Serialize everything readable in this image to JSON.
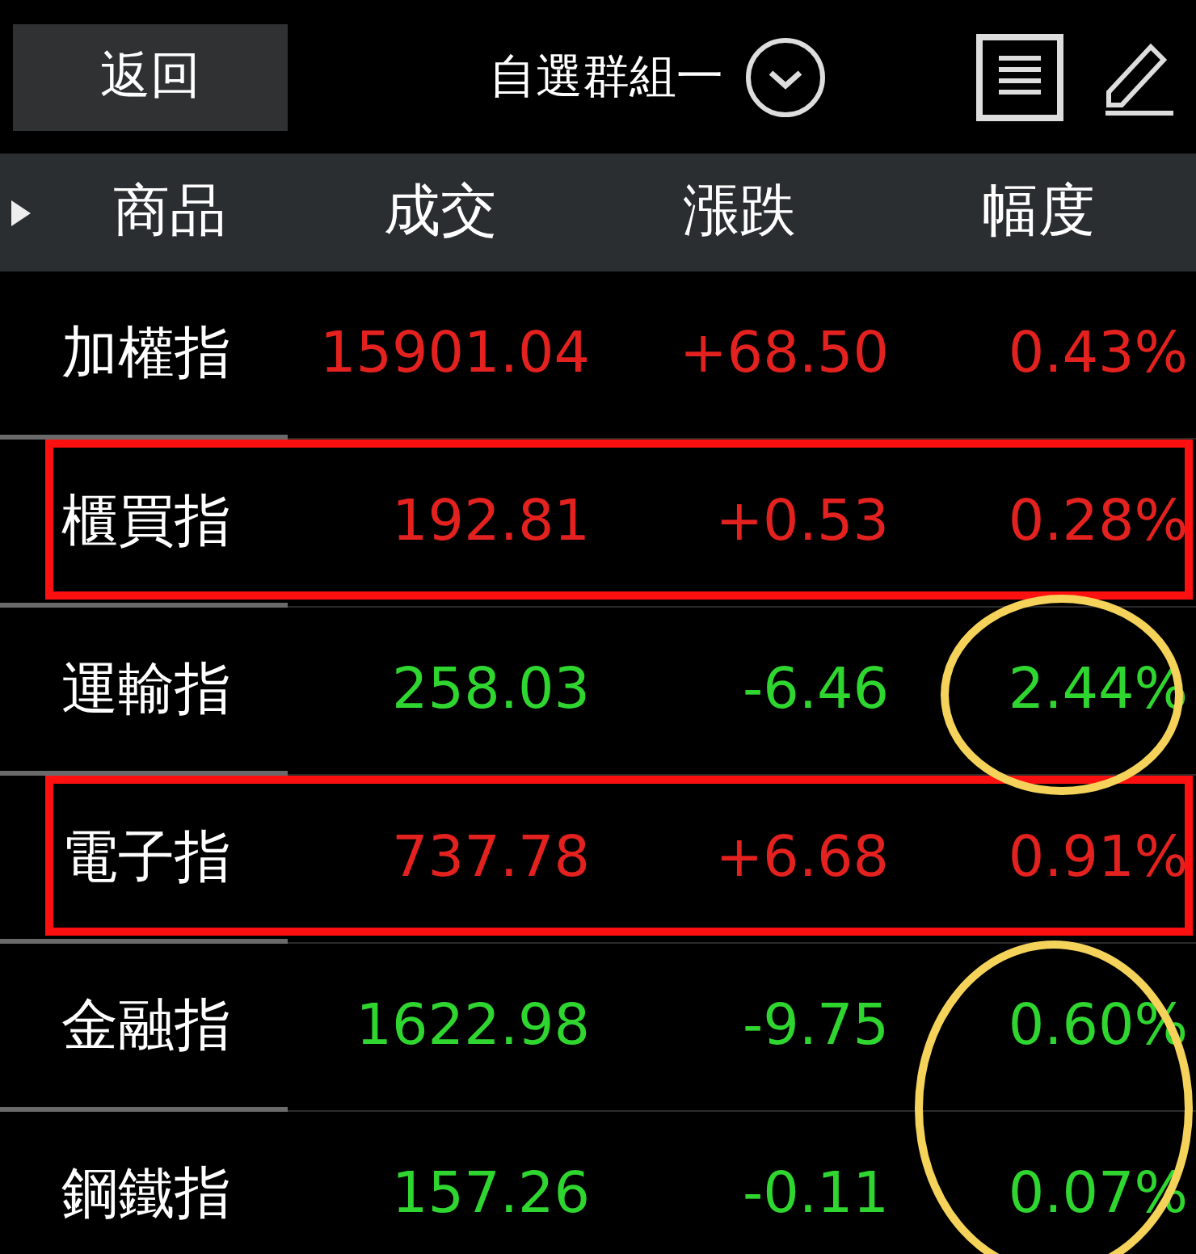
{
  "header": {
    "back_button": "返回",
    "title": "自選群組一"
  },
  "columns": [
    "商品",
    "成交",
    "漲跌",
    "幅度"
  ],
  "rows": [
    {
      "name": "加權指",
      "price": "15901.04",
      "change": "+68.50",
      "percent": "0.43%",
      "color": "#e3211f",
      "boxed": false,
      "circled": false
    },
    {
      "name": "櫃買指",
      "price": "192.81",
      "change": "+0.53",
      "percent": "0.28%",
      "color": "#e3211f",
      "boxed": true,
      "circled": false
    },
    {
      "name": "運輸指",
      "price": "258.03",
      "change": "-6.46",
      "percent": "2.44%",
      "color": "#2fd62f",
      "boxed": false,
      "circled": true
    },
    {
      "name": "電子指",
      "price": "737.78",
      "change": "+6.68",
      "percent": "0.91%",
      "color": "#e3211f",
      "boxed": true,
      "circled": false
    },
    {
      "name": "金融指",
      "price": "1622.98",
      "change": "-9.75",
      "percent": "0.60%",
      "color": "#2fd62f",
      "boxed": false,
      "circled": true
    },
    {
      "name": "鋼鐵指",
      "price": "157.26",
      "change": "-0.11",
      "percent": "0.07%",
      "color": "#2fd62f",
      "boxed": false,
      "circled": true
    }
  ]
}
